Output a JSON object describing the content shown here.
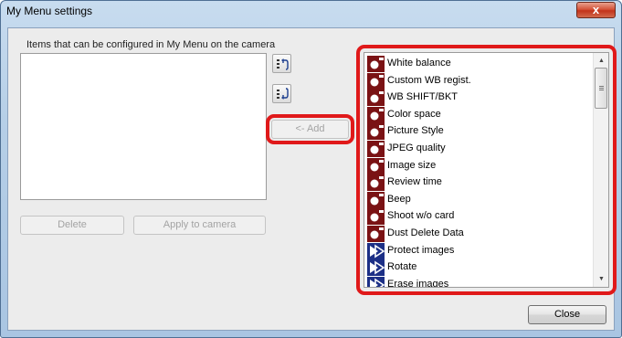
{
  "window": {
    "title": "My Menu settings",
    "close_glyph": "x"
  },
  "group_label": "Items that can be configured in My Menu on the camera",
  "buttons": {
    "add": "<- Add",
    "delete": "Delete",
    "apply": "Apply to camera",
    "close": "Close"
  },
  "icons": {
    "move_up": "move-up-icon",
    "move_down": "move-down-icon",
    "shooting_menu": "shooting-menu-icon",
    "playback_menu": "playback-menu-icon"
  },
  "colors": {
    "shooting_icon": "#7a1214",
    "playback_icon": "#1c2f86",
    "highlight": "#e0191a"
  },
  "menu_items": [
    {
      "label": "White balance",
      "category": "shooting"
    },
    {
      "label": "Custom WB regist.",
      "category": "shooting"
    },
    {
      "label": "WB SHIFT/BKT",
      "category": "shooting"
    },
    {
      "label": "Color space",
      "category": "shooting"
    },
    {
      "label": "Picture Style",
      "category": "shooting"
    },
    {
      "label": "JPEG quality",
      "category": "shooting"
    },
    {
      "label": "Image size",
      "category": "shooting"
    },
    {
      "label": "Review time",
      "category": "shooting"
    },
    {
      "label": "Beep",
      "category": "shooting"
    },
    {
      "label": "Shoot w/o card",
      "category": "shooting"
    },
    {
      "label": "Dust Delete Data",
      "category": "shooting"
    },
    {
      "label": "Protect images",
      "category": "playback"
    },
    {
      "label": "Rotate",
      "category": "playback"
    },
    {
      "label": "Erase images",
      "category": "playback"
    }
  ]
}
